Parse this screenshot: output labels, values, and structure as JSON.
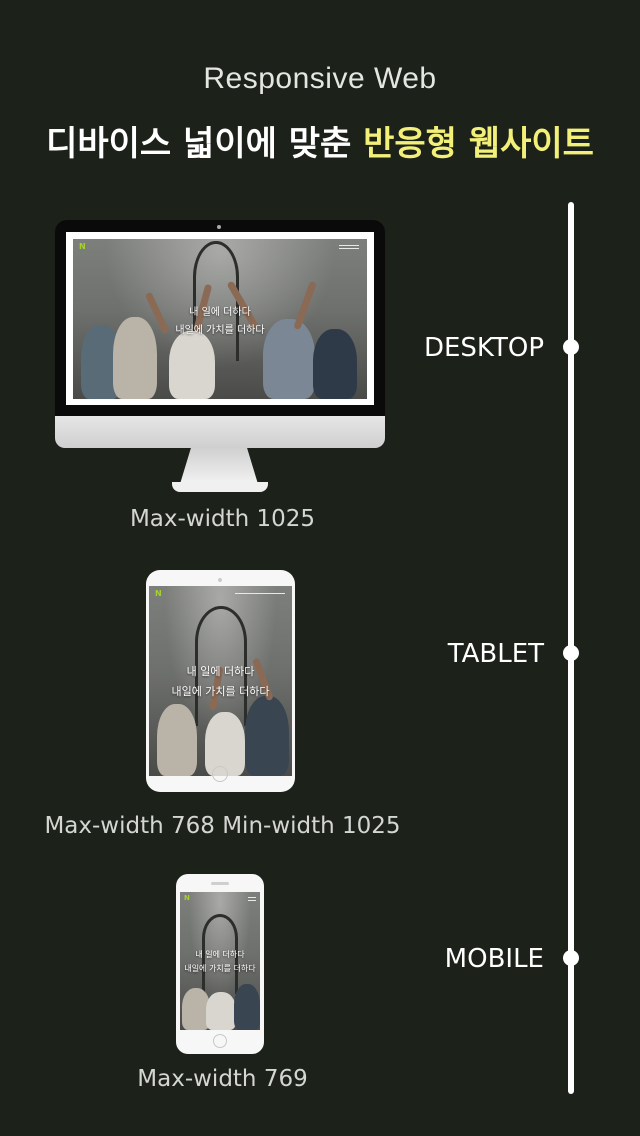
{
  "header": {
    "title_en": "Responsive Web",
    "title_kr_prefix": "디바이스 넓이에 맞춘 ",
    "title_kr_highlight": "반응형 웹사이트"
  },
  "colors": {
    "background": "#1c211a",
    "highlight": "#f3f07a",
    "logo": "#a6d22c"
  },
  "hero_text": {
    "line1": "내 일에 더하다",
    "line2": "내일에 가치를 더하다"
  },
  "logo_letter": "N",
  "devices": [
    {
      "label": "DESKTOP",
      "caption": "Max-width 1025",
      "icon": "desktop-monitor-icon"
    },
    {
      "label": "TABLET",
      "caption": "Max-width 768 Min-width 1025",
      "icon": "tablet-icon"
    },
    {
      "label": "MOBILE",
      "caption": "Max-width 769",
      "icon": "mobile-phone-icon"
    }
  ]
}
